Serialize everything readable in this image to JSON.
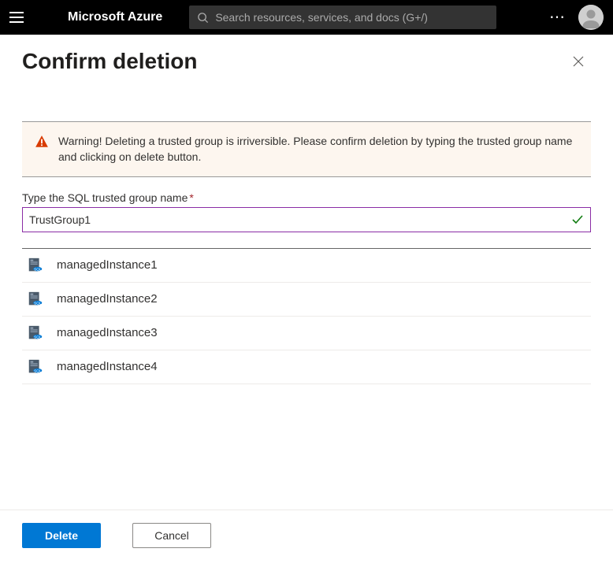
{
  "topbar": {
    "brand": "Microsoft Azure",
    "search_placeholder": "Search resources, services, and docs (G+/)"
  },
  "panel": {
    "title": "Confirm deletion"
  },
  "warning": {
    "text": "Warning! Deleting a trusted group is irriversible. Please confirm deletion by typing the trusted group name and clicking on delete button."
  },
  "field": {
    "label": "Type the SQL trusted group name",
    "value": "TrustGroup1"
  },
  "instances": [
    {
      "name": "managedInstance1"
    },
    {
      "name": "managedInstance2"
    },
    {
      "name": "managedInstance3"
    },
    {
      "name": "managedInstance4"
    }
  ],
  "footer": {
    "delete_label": "Delete",
    "cancel_label": "Cancel"
  }
}
